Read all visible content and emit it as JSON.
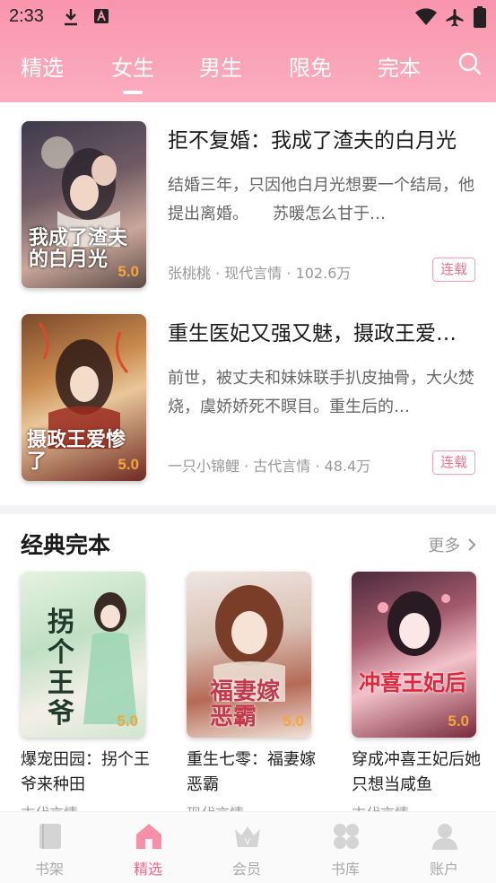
{
  "status_bar": {
    "time": "2:33"
  },
  "tabs": [
    {
      "label": "精选",
      "active": false
    },
    {
      "label": "女生",
      "active": true
    },
    {
      "label": "男生",
      "active": false
    },
    {
      "label": "限免",
      "active": false
    },
    {
      "label": "完本",
      "active": false
    }
  ],
  "books": [
    {
      "title": "拒不复婚：我成了渣夫的白月光",
      "description": "结婚三年，只因他白月光想要一个结局，他提出离婚。　　苏暖怎么甘于…",
      "author": "张桃桃",
      "category": "现代言情",
      "count": "102.6万",
      "status": "连载",
      "rating": "5.0",
      "cover_text": "我成了渣夫的白月光"
    },
    {
      "title": "重生医妃又强又魅，摄政王爱…",
      "description": "前世，被丈夫和妹妹联手扒皮抽骨，大火焚烧，虞娇娇死不瞑目。重生后的…",
      "author": "一只小锦鲤",
      "category": "古代言情",
      "count": "48.4万",
      "status": "连载",
      "rating": "5.0",
      "cover_text": "摄政王爱惨了"
    }
  ],
  "section": {
    "title": "经典完本",
    "more": "更多"
  },
  "grid": [
    {
      "title": "爆宠田园：拐个王爷来种田",
      "category": "古代言情",
      "rating": "5.0",
      "cover_text": "拐个王爷"
    },
    {
      "title": "重生七零：福妻嫁恶霸",
      "category": "现代言情",
      "rating": "5.0",
      "cover_text": "福妻嫁恶霸"
    },
    {
      "title": "穿成冲喜王妃后她只想当咸鱼",
      "category": "古代言情",
      "rating": "5.0",
      "cover_text": "冲喜王妃后"
    }
  ],
  "bottom_nav": [
    {
      "label": "书架",
      "icon": "bookshelf-icon",
      "active": false
    },
    {
      "label": "精选",
      "icon": "home-icon",
      "active": true
    },
    {
      "label": "会员",
      "icon": "crown-icon",
      "active": false
    },
    {
      "label": "书库",
      "icon": "grid-icon",
      "active": false
    },
    {
      "label": "账户",
      "icon": "user-icon",
      "active": false
    }
  ],
  "colors": {
    "header": "#f995ad",
    "accent": "#f46b8a",
    "rating": "#f5a53c"
  }
}
